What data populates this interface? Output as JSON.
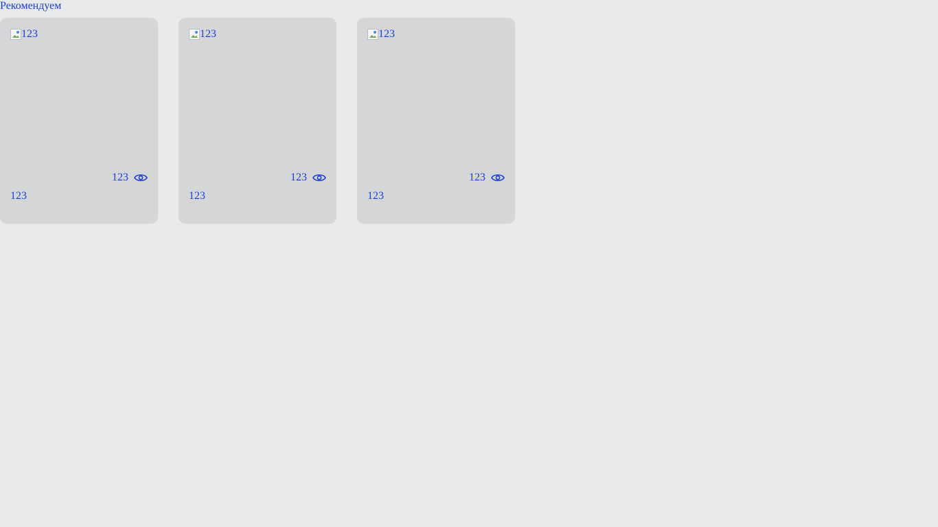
{
  "section": {
    "title": "Рекомендуем"
  },
  "cards": [
    {
      "image_alt": "123",
      "views": "123",
      "title": "123"
    },
    {
      "image_alt": "123",
      "views": "123",
      "title": "123"
    },
    {
      "image_alt": "123",
      "views": "123",
      "title": "123"
    }
  ],
  "icons": {
    "views": "eye-icon",
    "image": "broken-image-icon"
  },
  "colors": {
    "background": "#e8e9eb",
    "card": "#d5d6d8",
    "text": "#1a3fd1"
  }
}
